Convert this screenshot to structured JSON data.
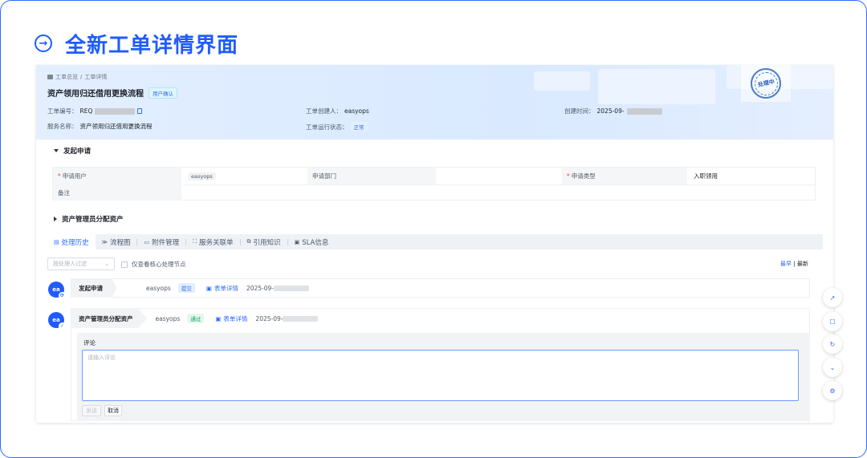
{
  "hero": {
    "title": "全新工单详情界面"
  },
  "breadcrumb": {
    "root": "工单总览",
    "separator": "/",
    "current": "工单详情"
  },
  "ticket": {
    "title": "资产领用归还借用更换流程",
    "status_tag": "用户确认",
    "stamp_text": "处理中",
    "number_label": "工单编号：",
    "number_prefix": "REQ",
    "creator_label": "工单创建人：",
    "creator": "easyops",
    "created_label": "创建时间：",
    "created_prefix": "2025-09-",
    "service_label": "服务名称：",
    "service": "资产领用归还借用更换流程",
    "run_status_label": "工单运行状态：",
    "run_status": "正常"
  },
  "sections": {
    "apply": "发起申请",
    "assign": "资产管理员分配资产"
  },
  "form": {
    "user_label": "申请用户",
    "user_value": "easyops",
    "dept_label": "申请部门",
    "type_label": "申请类型",
    "type_value": "入职领用",
    "note_label": "备注"
  },
  "tabs": [
    {
      "icon": "▤",
      "label": "处理历史"
    },
    {
      "icon": "≫",
      "label": "流程图"
    },
    {
      "icon": "▭",
      "label": "附件管理"
    },
    {
      "icon": "⛶",
      "label": "服务关联单"
    },
    {
      "icon": "⧉",
      "label": "引用知识"
    },
    {
      "icon": "▣",
      "label": "SLA信息"
    }
  ],
  "filter": {
    "placeholder": "按处理人过滤",
    "core_only": "仅查看核心处理节点",
    "sort_earliest": "最早",
    "sort_sep": "|",
    "sort_latest": "最新"
  },
  "timeline": [
    {
      "avatar": "ea",
      "title": "发起申请",
      "user": "easyops",
      "tag": "提交",
      "link": "表单详情",
      "time_prefix": "2025-09-"
    },
    {
      "avatar": "ea",
      "title": "资产管理员分配资产",
      "user": "easyops",
      "tag": "通过",
      "link": "表单详情",
      "time_prefix": "2025-09-"
    }
  ],
  "comment": {
    "label": "评论",
    "placeholder": "请输入评论",
    "send": "发送",
    "cancel": "取消"
  },
  "colors": {
    "accent": "#1f5cff",
    "success": "#00a85a",
    "required": "#f53f3f"
  }
}
